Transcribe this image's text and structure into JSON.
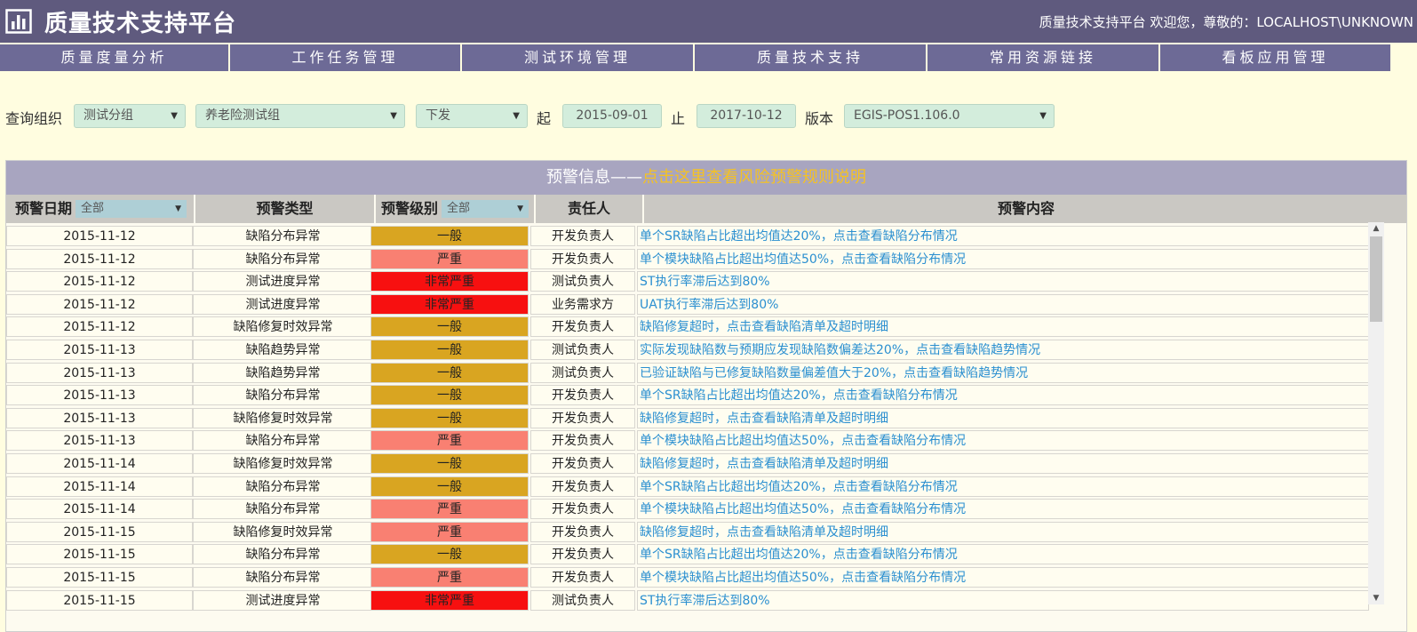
{
  "header": {
    "title": "质量技术支持平台",
    "welcome": "质量技术支持平台 欢迎您，尊敬的：LOCALHOST\\UNKNOWN",
    "logo_icon": "bar-chart-icon"
  },
  "nav": [
    {
      "label": "质量度量分析"
    },
    {
      "label": "工作任务管理"
    },
    {
      "label": "测试环境管理"
    },
    {
      "label": "质量技术支持"
    },
    {
      "label": "常用资源链接"
    },
    {
      "label": "看板应用管理"
    }
  ],
  "filter": {
    "org_label": "查询组织",
    "org_level": "测试分组",
    "group": "养老险测试组",
    "scope": "下发",
    "start_label": "起",
    "start_date": "2015-09-01",
    "end_label": "止",
    "end_date": "2017-10-12",
    "version_label": "版本",
    "version": "EGIS-POS1.106.0"
  },
  "panel": {
    "title_prefix": "预警信息——",
    "title_link": "点击这里查看风险预警规则说明"
  },
  "table": {
    "headers": {
      "date": "预警日期",
      "date_filter": "全部",
      "type": "预警类型",
      "level": "预警级别",
      "level_filter": "全部",
      "owner": "责任人",
      "content": "预警内容"
    },
    "rows": [
      {
        "date": "2015-11-12",
        "type": "缺陷分布异常",
        "level": "一般",
        "level_key": "normal",
        "owner": "开发负责人",
        "content": "单个SR缺陷占比超出均值达20%，点击查看缺陷分布情况"
      },
      {
        "date": "2015-11-12",
        "type": "缺陷分布异常",
        "level": "严重",
        "level_key": "serious",
        "owner": "开发负责人",
        "content": "单个模块缺陷占比超出均值达50%，点击查看缺陷分布情况"
      },
      {
        "date": "2015-11-12",
        "type": "测试进度异常",
        "level": "非常严重",
        "level_key": "critical",
        "owner": "测试负责人",
        "content": "ST执行率滞后达到80%"
      },
      {
        "date": "2015-11-12",
        "type": "测试进度异常",
        "level": "非常严重",
        "level_key": "critical",
        "owner": "业务需求方",
        "content": "UAT执行率滞后达到80%"
      },
      {
        "date": "2015-11-12",
        "type": "缺陷修复时效异常",
        "level": "一般",
        "level_key": "normal",
        "owner": "开发负责人",
        "content": "缺陷修复超时，点击查看缺陷清单及超时明细"
      },
      {
        "date": "2015-11-13",
        "type": "缺陷趋势异常",
        "level": "一般",
        "level_key": "normal",
        "owner": "测试负责人",
        "content": "实际发现缺陷数与预期应发现缺陷数偏差达20%，点击查看缺陷趋势情况"
      },
      {
        "date": "2015-11-13",
        "type": "缺陷趋势异常",
        "level": "一般",
        "level_key": "normal",
        "owner": "测试负责人",
        "content": "已验证缺陷与已修复缺陷数量偏差值大于20%，点击查看缺陷趋势情况"
      },
      {
        "date": "2015-11-13",
        "type": "缺陷分布异常",
        "level": "一般",
        "level_key": "normal",
        "owner": "开发负责人",
        "content": "单个SR缺陷占比超出均值达20%，点击查看缺陷分布情况"
      },
      {
        "date": "2015-11-13",
        "type": "缺陷修复时效异常",
        "level": "一般",
        "level_key": "normal",
        "owner": "开发负责人",
        "content": "缺陷修复超时，点击查看缺陷清单及超时明细"
      },
      {
        "date": "2015-11-13",
        "type": "缺陷分布异常",
        "level": "严重",
        "level_key": "serious",
        "owner": "开发负责人",
        "content": "单个模块缺陷占比超出均值达50%，点击查看缺陷分布情况"
      },
      {
        "date": "2015-11-14",
        "type": "缺陷修复时效异常",
        "level": "一般",
        "level_key": "normal",
        "owner": "开发负责人",
        "content": "缺陷修复超时，点击查看缺陷清单及超时明细"
      },
      {
        "date": "2015-11-14",
        "type": "缺陷分布异常",
        "level": "一般",
        "level_key": "normal",
        "owner": "开发负责人",
        "content": "单个SR缺陷占比超出均值达20%，点击查看缺陷分布情况"
      },
      {
        "date": "2015-11-14",
        "type": "缺陷分布异常",
        "level": "严重",
        "level_key": "serious",
        "owner": "开发负责人",
        "content": "单个模块缺陷占比超出均值达50%，点击查看缺陷分布情况"
      },
      {
        "date": "2015-11-15",
        "type": "缺陷修复时效异常",
        "level": "严重",
        "level_key": "serious",
        "owner": "开发负责人",
        "content": "缺陷修复超时，点击查看缺陷清单及超时明细"
      },
      {
        "date": "2015-11-15",
        "type": "缺陷分布异常",
        "level": "一般",
        "level_key": "normal",
        "owner": "开发负责人",
        "content": "单个SR缺陷占比超出均值达20%，点击查看缺陷分布情况"
      },
      {
        "date": "2015-11-15",
        "type": "缺陷分布异常",
        "level": "严重",
        "level_key": "serious",
        "owner": "开发负责人",
        "content": "单个模块缺陷占比超出均值达50%，点击查看缺陷分布情况"
      },
      {
        "date": "2015-11-15",
        "type": "测试进度异常",
        "level": "非常严重",
        "level_key": "critical",
        "owner": "测试负责人",
        "content": "ST执行率滞后达到80%"
      }
    ]
  },
  "colors": {
    "header_bg": "#5f5a7e",
    "nav_bg": "#6d6a96",
    "page_bg": "#fffde0",
    "level_normal": "#d9a521",
    "level_serious": "#f98072",
    "level_critical": "#f71010",
    "link": "#2a8fd0"
  }
}
